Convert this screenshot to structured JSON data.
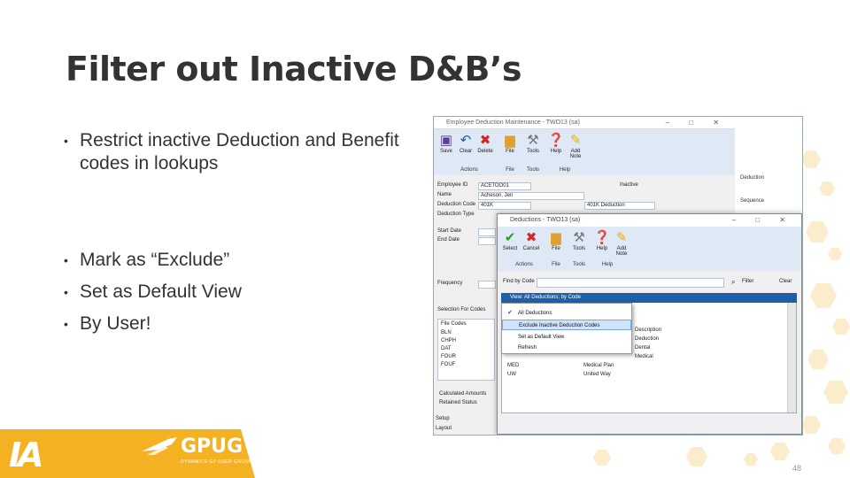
{
  "slide": {
    "title": "Filter out Inactive D&B’s",
    "bullets": [
      "Restrict inactive Deduction and Benefit codes in lookups",
      "Mark as “Exclude”",
      "Set as Default View",
      "By User!"
    ],
    "bullet_glyph": "•",
    "page_number": "48"
  },
  "branding": {
    "ia_logo_text": "IA",
    "gpug_name": "GPUG",
    "gpug_tagline": "DYNAMICS GP USER GROUP",
    "accent_color": "#f4b223"
  },
  "screenshot": {
    "window1": {
      "title": "Employee Deduction Maintenance - TWO13 (sa)",
      "controls": "–  □  ✕",
      "ribbon_buttons": [
        {
          "label": "Save",
          "icon": "save-icon"
        },
        {
          "label": "Clear",
          "icon": "undo-icon"
        },
        {
          "label": "Delete",
          "icon": "delete-icon"
        },
        {
          "label": "File",
          "icon": "folder-icon"
        },
        {
          "label": "Tools",
          "icon": "tools-icon"
        },
        {
          "label": "Help",
          "icon": "help-icon"
        },
        {
          "label": "Add Note",
          "icon": "note-icon"
        }
      ],
      "ribbon_groups": [
        "Actions",
        "File",
        "Tools",
        "Help"
      ],
      "form_labels": [
        "Employee ID",
        "Name",
        "Deduction Code",
        "Deduction Type",
        "Start Date",
        "End Date",
        "Frequency",
        "Selection For Codes",
        "File Codes"
      ],
      "form_values": [
        "ACETOO01",
        "Acheson, Jen",
        "401K",
        "401K Deduction",
        "Inactive"
      ],
      "left_list": [
        "BLN",
        "CHPH",
        "DAT",
        "FOUR",
        "FOUF"
      ],
      "bottom_left": [
        "Calculated Amounts",
        "Retained Status",
        "Setup",
        "Layout"
      ],
      "right_panel_text": [
        "Deduction",
        "Sequence"
      ]
    },
    "window2": {
      "title": "Deductions - TWO13 (sa)",
      "controls": "–  □  ✕",
      "ribbon_buttons": [
        {
          "label": "Select",
          "icon": "check-icon"
        },
        {
          "label": "Cancel",
          "icon": "cancel-icon"
        },
        {
          "label": "File",
          "icon": "folder-icon"
        },
        {
          "label": "Tools",
          "icon": "tools-icon"
        },
        {
          "label": "Help",
          "icon": "help-icon"
        },
        {
          "label": "Add Note",
          "icon": "note-icon"
        }
      ],
      "ribbon_groups": [
        "Actions",
        "File",
        "Tools",
        "Help"
      ],
      "find_label": "Find by Code",
      "filter_label": "Filter",
      "clear_label": "Clear",
      "view_bar": "View: All Deductions; by Code",
      "menu_items": [
        {
          "label": "All Deductions",
          "checked": true
        },
        {
          "label": "Exclude Inactive Deduction Codes",
          "checked": false
        },
        {
          "label": "Set as Default View",
          "checked": false
        },
        {
          "label": "Refresh",
          "checked": false
        }
      ],
      "list_rows": [
        {
          "code": "",
          "desc": "Description"
        },
        {
          "code": "",
          "desc": "Deduction"
        },
        {
          "code": "",
          "desc": "Dental"
        },
        {
          "code": "",
          "desc": "Medical"
        },
        {
          "code": "MED",
          "desc": "Medical Plan"
        },
        {
          "code": "UW",
          "desc": "United Way"
        }
      ]
    }
  }
}
